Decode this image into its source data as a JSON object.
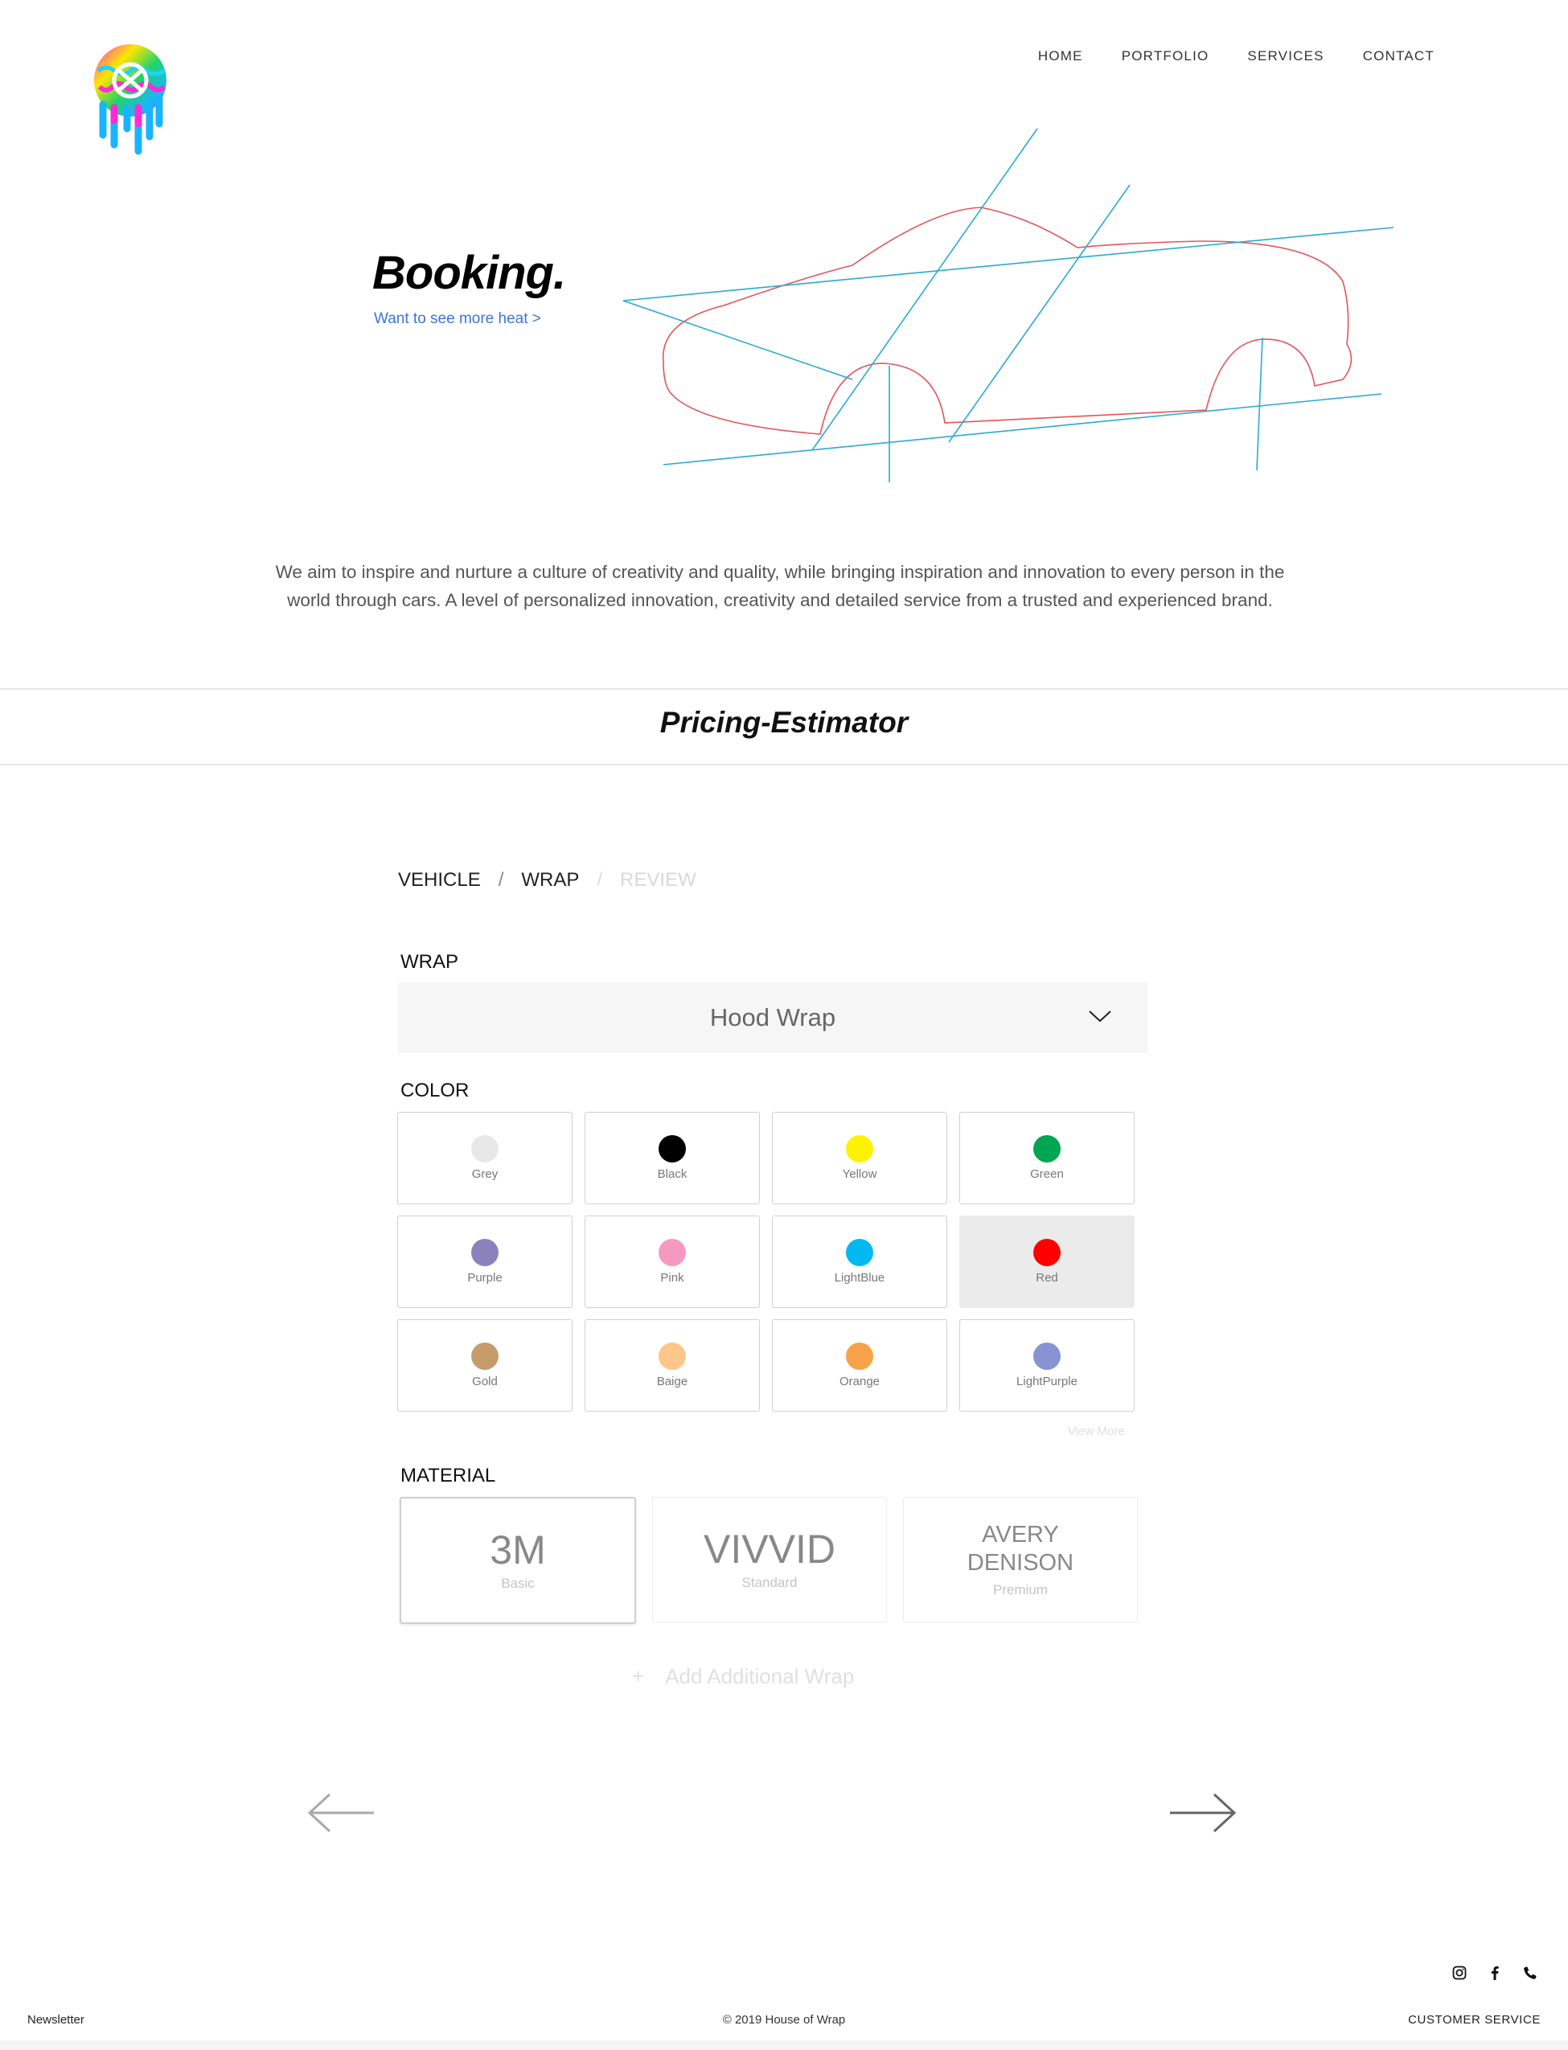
{
  "header": {
    "nav": [
      "HOME",
      "PORTFOLIO",
      "SERVICES",
      "CONTACT"
    ]
  },
  "hero": {
    "title": "Booking.",
    "link": "Want to see more heat >"
  },
  "intro": "We aim to inspire and nurture a culture of creativity and quality, while bringing inspiration and innovation to every person in the world through cars. A level of personalized innovation, creativity and detailed service from a trusted and experienced brand.",
  "section_title": "Pricing-Estimator",
  "breadcrumb": {
    "steps": [
      "VEHICLE",
      "WRAP",
      "REVIEW"
    ],
    "separator": "/"
  },
  "wrap": {
    "label": "WRAP",
    "selected": "Hood Wrap"
  },
  "color": {
    "label": "COLOR",
    "selected": "Red",
    "options": [
      {
        "name": "Grey",
        "hex": "#e8e8e8"
      },
      {
        "name": "Black",
        "hex": "#000000"
      },
      {
        "name": "Yellow",
        "hex": "#fff200"
      },
      {
        "name": "Green",
        "hex": "#00a651"
      },
      {
        "name": "Purple",
        "hex": "#8b82bd"
      },
      {
        "name": "Pink",
        "hex": "#f49ac1"
      },
      {
        "name": "LightBlue",
        "hex": "#00b9f1"
      },
      {
        "name": "Red",
        "hex": "#ff0000"
      },
      {
        "name": "Gold",
        "hex": "#c69c6d"
      },
      {
        "name": "Baige",
        "hex": "#fdc68a"
      },
      {
        "name": "Orange",
        "hex": "#f7a24a"
      },
      {
        "name": "LightPurple",
        "hex": "#8793d3"
      }
    ],
    "view_more": "View More"
  },
  "material": {
    "label": "MATERIAL",
    "selected": "3M",
    "options": [
      {
        "name": "3M",
        "tier": "Basic"
      },
      {
        "name": "VIVVID",
        "tier": "Standard"
      },
      {
        "name": "AVERY DENISON",
        "tier": "Premium"
      }
    ]
  },
  "add_wrap": {
    "icon": "+",
    "label": "Add Additional Wrap"
  },
  "navigation_icons": [
    "arrow-left-icon",
    "arrow-right-icon"
  ],
  "footer": {
    "social_icons": [
      "instagram-icon",
      "facebook-icon",
      "phone-icon"
    ],
    "newsletter": "Newsletter",
    "copyright": "© 2019 House of Wrap",
    "customer_service": "CUSTOMER SERVICE"
  }
}
